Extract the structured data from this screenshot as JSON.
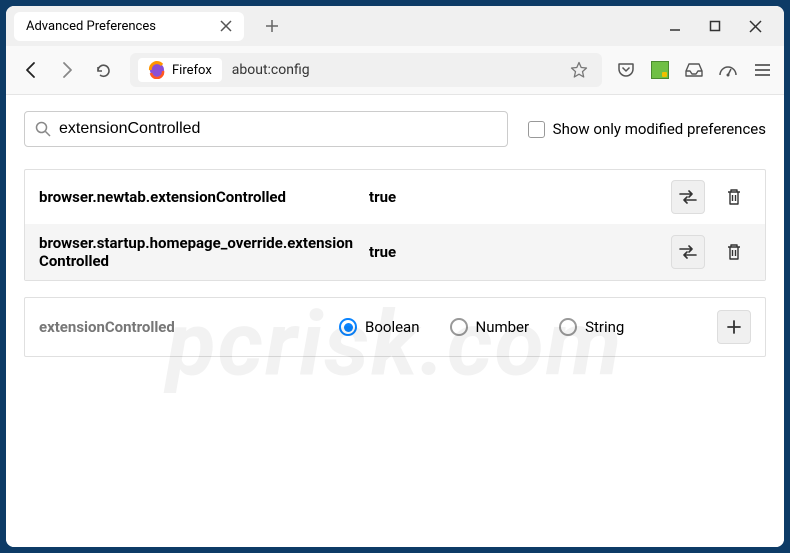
{
  "window": {
    "tab_title": "Advanced Preferences"
  },
  "toolbar": {
    "identity_label": "Firefox",
    "url": "about:config"
  },
  "search": {
    "value": "extensionControlled",
    "checkbox_label": "Show only modified preferences"
  },
  "prefs": [
    {
      "key": "browser.newtab.extensionControlled",
      "value": "true"
    },
    {
      "key": "browser.startup.homepage_override.extensionControlled",
      "value": "true"
    }
  ],
  "add": {
    "key": "extensionControlled",
    "types": [
      "Boolean",
      "Number",
      "String"
    ],
    "selected": "Boolean"
  },
  "watermark": "pcrisk.com"
}
